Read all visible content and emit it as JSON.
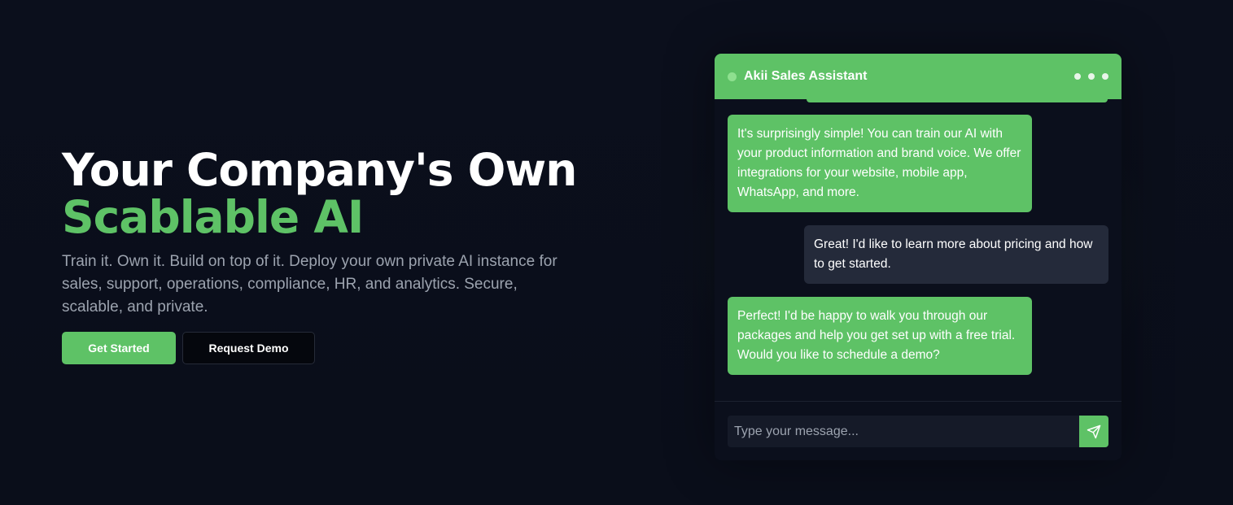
{
  "hero": {
    "title_line1": "Your Company's Own",
    "title_line2": "Scablable AI",
    "subtitle": "Train it. Own it. Build on top of it. Deploy your own private AI instance for sales, support, operations, compliance, HR, and analytics. Secure, scalable, and private.",
    "primary_button": "Get Started",
    "secondary_button": "Request Demo"
  },
  "chat": {
    "title": "Akii Sales Assistant",
    "messages": [
      {
        "role": "bot",
        "text": "It's surprisingly simple! You can train our AI with your product information and brand voice. We offer integrations for your website, mobile app, WhatsApp, and more."
      },
      {
        "role": "user",
        "text": "Great! I'd like to learn more about pricing and how to get started."
      },
      {
        "role": "bot",
        "text": "Perfect! I'd be happy to walk you through our packages and help you get set up with a free trial. Would you like to schedule a demo?"
      }
    ],
    "input_placeholder": "Type your message...",
    "icons": {
      "status": "status-dot",
      "menu": "more-horizontal-icon",
      "send": "send-icon"
    }
  },
  "colors": {
    "background": "#0a0e1a",
    "accent": "#5ec266",
    "user_bubble": "#242a3a",
    "text_muted": "#9ca3af"
  }
}
